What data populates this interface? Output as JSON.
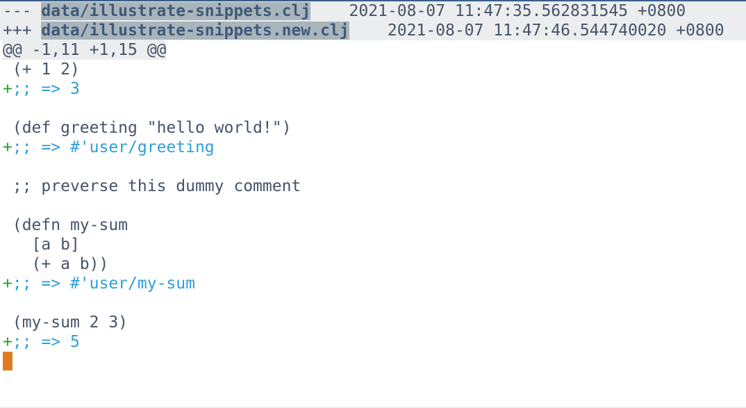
{
  "diff": {
    "old_header": {
      "prefix": "--- ",
      "filename": "data/illustrate-snippets.clj",
      "timestamp": "    2021-08-07 11:47:35.562831545 +0800"
    },
    "new_header": {
      "prefix": "+++ ",
      "filename": "data/illustrate-snippets.new.clj",
      "timestamp": "    2021-08-07 11:47:46.544740020 +0800"
    },
    "hunk_header": "@@ -1,11 +1,15 @@",
    "lines": [
      {
        "type": "context",
        "prefix": " ",
        "text": "(+ 1 2)"
      },
      {
        "type": "added",
        "prefix": "+",
        "text": ";; => 3"
      },
      {
        "type": "context",
        "prefix": " ",
        "text": ""
      },
      {
        "type": "context",
        "prefix": " ",
        "text": "(def greeting \"hello world!\")"
      },
      {
        "type": "added",
        "prefix": "+",
        "text": ";; => #'user/greeting"
      },
      {
        "type": "context",
        "prefix": " ",
        "text": ""
      },
      {
        "type": "context",
        "prefix": " ",
        "text": ";; preverse this dummy comment"
      },
      {
        "type": "context",
        "prefix": " ",
        "text": ""
      },
      {
        "type": "context",
        "prefix": " ",
        "text": "(defn my-sum"
      },
      {
        "type": "context",
        "prefix": " ",
        "text": "  [a b]"
      },
      {
        "type": "context",
        "prefix": " ",
        "text": "  (+ a b))"
      },
      {
        "type": "added",
        "prefix": "+",
        "text": ";; => #'user/my-sum"
      },
      {
        "type": "context",
        "prefix": " ",
        "text": ""
      },
      {
        "type": "context",
        "prefix": " ",
        "text": "(my-sum 2 3)"
      },
      {
        "type": "added",
        "prefix": "+",
        "text": ";; => 5"
      }
    ]
  },
  "colors": {
    "added_prefix": "#2aa12a",
    "added_comment": "#2e9fd8",
    "cursor": "#e07b20",
    "filename_highlight": "#a9b5bc",
    "header_bg": "#ecedee"
  }
}
